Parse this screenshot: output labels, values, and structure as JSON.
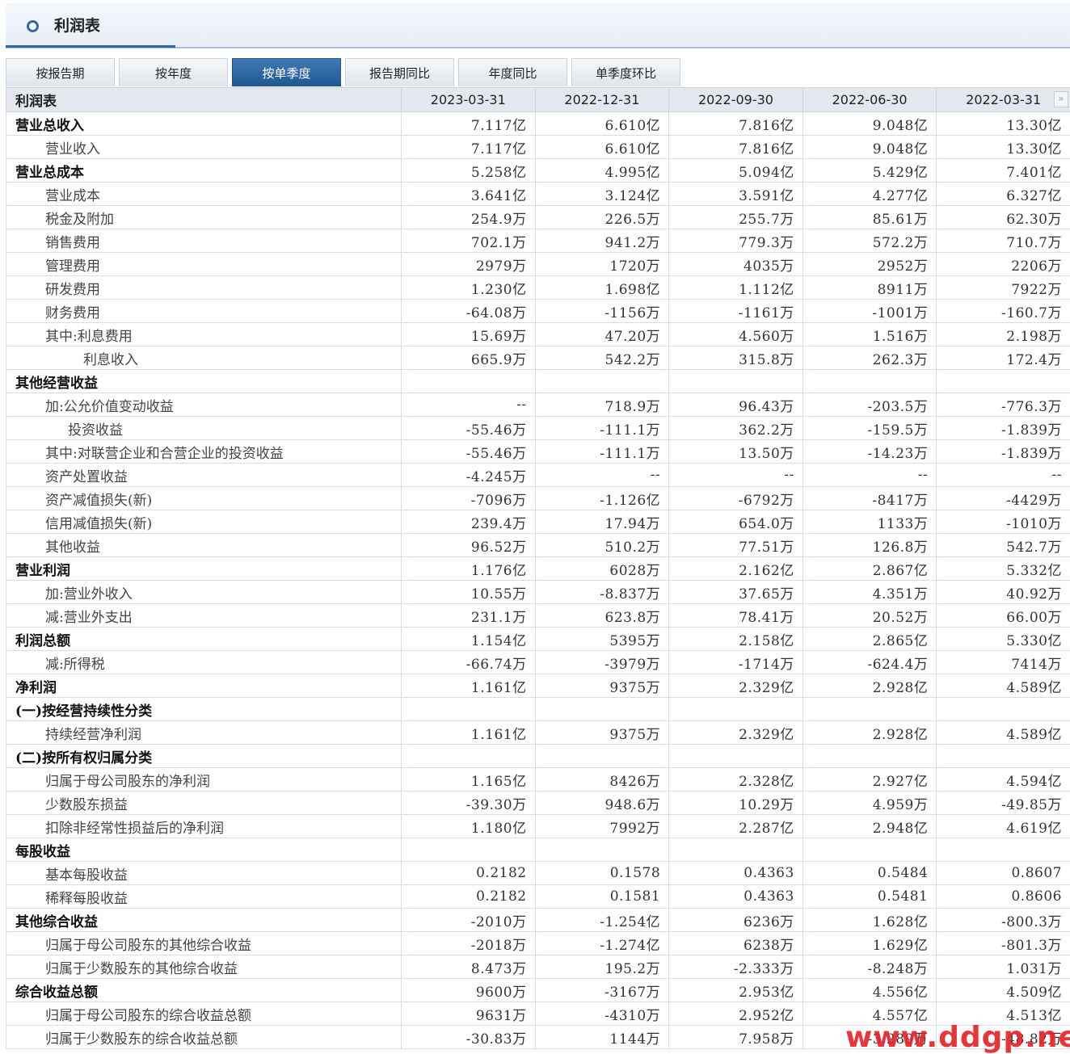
{
  "header": {
    "title": "利润表"
  },
  "tabs": [
    "按报告期",
    "按年度",
    "按单季度",
    "报告期同比",
    "年度同比",
    "单季度环比"
  ],
  "active_tab": 2,
  "table": {
    "corner_label": "利润表",
    "columns": [
      "2023-03-31",
      "2022-12-31",
      "2022-09-30",
      "2022-06-30",
      "2022-03-31"
    ],
    "rows": [
      {
        "label": "营业总收入",
        "style": "bold",
        "values": [
          "7.117亿",
          "6.610亿",
          "7.816亿",
          "9.048亿",
          "13.30亿"
        ]
      },
      {
        "label": "营业收入",
        "style": "l1",
        "values": [
          "7.117亿",
          "6.610亿",
          "7.816亿",
          "9.048亿",
          "13.30亿"
        ]
      },
      {
        "label": "营业总成本",
        "style": "bold",
        "values": [
          "5.258亿",
          "4.995亿",
          "5.094亿",
          "5.429亿",
          "7.401亿"
        ]
      },
      {
        "label": "营业成本",
        "style": "l1",
        "values": [
          "3.641亿",
          "3.124亿",
          "3.591亿",
          "4.277亿",
          "6.327亿"
        ]
      },
      {
        "label": "税金及附加",
        "style": "l1",
        "values": [
          "254.9万",
          "226.5万",
          "255.7万",
          "85.61万",
          "62.30万"
        ]
      },
      {
        "label": "销售费用",
        "style": "l1",
        "values": [
          "702.1万",
          "941.2万",
          "779.3万",
          "572.2万",
          "710.7万"
        ]
      },
      {
        "label": "管理费用",
        "style": "l1",
        "values": [
          "2979万",
          "1720万",
          "4035万",
          "2952万",
          "2206万"
        ]
      },
      {
        "label": "研发费用",
        "style": "l1",
        "values": [
          "1.230亿",
          "1.698亿",
          "1.112亿",
          "8911万",
          "7922万"
        ]
      },
      {
        "label": "财务费用",
        "style": "l1",
        "values": [
          "-64.08万",
          "-1156万",
          "-1161万",
          "-1001万",
          "-160.7万"
        ]
      },
      {
        "label": "其中:利息费用",
        "style": "l1",
        "values": [
          "15.69万",
          "47.20万",
          "4.560万",
          "1.516万",
          "2.198万"
        ]
      },
      {
        "label": "利息收入",
        "style": "l3",
        "values": [
          "665.9万",
          "542.2万",
          "315.8万",
          "262.3万",
          "172.4万"
        ]
      },
      {
        "label": "其他经营收益",
        "style": "bold",
        "values": [
          "",
          "",
          "",
          "",
          ""
        ]
      },
      {
        "label": "加:公允价值变动收益",
        "style": "l1",
        "values": [
          "--",
          "718.9万",
          "96.43万",
          "-203.5万",
          "-776.3万"
        ]
      },
      {
        "label": "投资收益",
        "style": "l2",
        "values": [
          "-55.46万",
          "-111.1万",
          "362.2万",
          "-159.5万",
          "-1.839万"
        ]
      },
      {
        "label": "其中:对联营企业和合营企业的投资收益",
        "style": "l1",
        "values": [
          "-55.46万",
          "-111.1万",
          "13.50万",
          "-14.23万",
          "-1.839万"
        ]
      },
      {
        "label": "资产处置收益",
        "style": "l1",
        "values": [
          "-4.245万",
          "--",
          "--",
          "--",
          "--"
        ]
      },
      {
        "label": "资产减值损失(新)",
        "style": "l1",
        "values": [
          "-7096万",
          "-1.126亿",
          "-6792万",
          "-8417万",
          "-4429万"
        ]
      },
      {
        "label": "信用减值损失(新)",
        "style": "l1",
        "values": [
          "239.4万",
          "17.94万",
          "654.0万",
          "1133万",
          "-1010万"
        ]
      },
      {
        "label": "其他收益",
        "style": "l1",
        "values": [
          "96.52万",
          "510.2万",
          "77.51万",
          "126.8万",
          "542.7万"
        ]
      },
      {
        "label": "营业利润",
        "style": "bold",
        "values": [
          "1.176亿",
          "6028万",
          "2.162亿",
          "2.867亿",
          "5.332亿"
        ]
      },
      {
        "label": "加:营业外收入",
        "style": "l1",
        "values": [
          "10.55万",
          "-8.837万",
          "37.65万",
          "4.351万",
          "40.92万"
        ]
      },
      {
        "label": "减:营业外支出",
        "style": "l1",
        "values": [
          "231.1万",
          "623.8万",
          "78.41万",
          "20.52万",
          "66.00万"
        ]
      },
      {
        "label": "利润总额",
        "style": "bold",
        "values": [
          "1.154亿",
          "5395万",
          "2.158亿",
          "2.865亿",
          "5.330亿"
        ]
      },
      {
        "label": "减:所得税",
        "style": "l1",
        "values": [
          "-66.74万",
          "-3979万",
          "-1714万",
          "-624.4万",
          "7414万"
        ]
      },
      {
        "label": "净利润",
        "style": "bold",
        "values": [
          "1.161亿",
          "9375万",
          "2.329亿",
          "2.928亿",
          "4.589亿"
        ]
      },
      {
        "label": "(一)按经营持续性分类",
        "style": "bold",
        "values": [
          "",
          "",
          "",
          "",
          ""
        ]
      },
      {
        "label": "持续经营净利润",
        "style": "l1",
        "values": [
          "1.161亿",
          "9375万",
          "2.329亿",
          "2.928亿",
          "4.589亿"
        ]
      },
      {
        "label": "(二)按所有权归属分类",
        "style": "bold",
        "values": [
          "",
          "",
          "",
          "",
          ""
        ]
      },
      {
        "label": "归属于母公司股东的净利润",
        "style": "l1",
        "values": [
          "1.165亿",
          "8426万",
          "2.328亿",
          "2.927亿",
          "4.594亿"
        ]
      },
      {
        "label": "少数股东损益",
        "style": "l1",
        "values": [
          "-39.30万",
          "948.6万",
          "10.29万",
          "4.959万",
          "-49.85万"
        ]
      },
      {
        "label": "扣除非经常性损益后的净利润",
        "style": "l1",
        "values": [
          "1.180亿",
          "7992万",
          "2.287亿",
          "2.948亿",
          "4.619亿"
        ]
      },
      {
        "label": "每股收益",
        "style": "bold",
        "values": [
          "",
          "",
          "",
          "",
          ""
        ]
      },
      {
        "label": "基本每股收益",
        "style": "l1",
        "values": [
          "0.2182",
          "0.1578",
          "0.4363",
          "0.5484",
          "0.8607"
        ]
      },
      {
        "label": "稀释每股收益",
        "style": "l1",
        "values": [
          "0.2182",
          "0.1581",
          "0.4363",
          "0.5481",
          "0.8606"
        ]
      },
      {
        "label": "其他综合收益",
        "style": "bold",
        "values": [
          "-2010万",
          "-1.254亿",
          "6236万",
          "1.628亿",
          "-800.3万"
        ]
      },
      {
        "label": "归属于母公司股东的其他综合收益",
        "style": "l1",
        "values": [
          "-2018万",
          "-1.274亿",
          "6238万",
          "1.629亿",
          "-801.3万"
        ]
      },
      {
        "label": "归属于少数股东的其他综合收益",
        "style": "l1",
        "values": [
          "8.473万",
          "195.2万",
          "-2.333万",
          "-8.248万",
          "1.031万"
        ]
      },
      {
        "label": "综合收益总额",
        "style": "bold",
        "values": [
          "9600万",
          "-3167万",
          "2.953亿",
          "4.556亿",
          "4.509亿"
        ]
      },
      {
        "label": "归属于母公司股东的综合收益总额",
        "style": "l1",
        "values": [
          "9631万",
          "-4310万",
          "2.952亿",
          "4.557亿",
          "4.513亿"
        ]
      },
      {
        "label": "归属于少数股东的综合收益总额",
        "style": "l1",
        "values": [
          "-30.83万",
          "1144万",
          "7.958万",
          "-3.289万",
          "-48.82万"
        ]
      }
    ]
  },
  "scroll_right_glyph": "»",
  "watermark": "www.ddgp.net",
  "colors": {
    "active_tab": "#1f5690",
    "accent": "#2b6aa6",
    "watermark": "#e8232a"
  }
}
